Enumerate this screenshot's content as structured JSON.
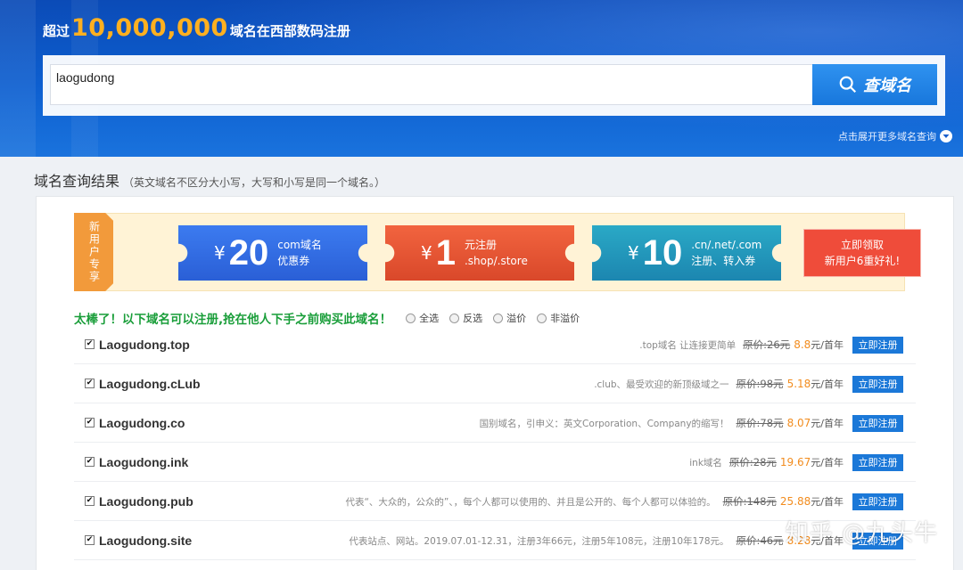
{
  "header": {
    "title_prefix": "超过",
    "title_number": "10,000,000",
    "title_suffix": "域名在西部数码注册",
    "search_value": "laogudong",
    "search_button": "查域名",
    "more_link": "点击展开更多域名查询"
  },
  "results": {
    "heading": "域名查询结果",
    "heading_note": "（英文域名不区分大小写，大写和小写是同一个域名。）"
  },
  "promo": {
    "tag": "新用户专享",
    "coupons": [
      {
        "yen": "¥",
        "amount": "20",
        "line1": "com域名",
        "line2": "优惠券",
        "color": "#2f6de3"
      },
      {
        "yen": "¥",
        "amount": "1",
        "line1": "元注册",
        "line2": ".shop/.store",
        "color": "#e65633"
      },
      {
        "yen": "¥",
        "amount": "10",
        "line1": ".cn/.net/.com",
        "line2": "注册、转入券",
        "color": "#2398bb"
      }
    ],
    "claim_line1": "立即领取",
    "claim_line2": "新用户6重好礼!"
  },
  "filter": {
    "congrats": "太棒了！以下域名可以注册,抢在他人下手之前购买此域名！",
    "options": [
      "全选",
      "反选",
      "溢价",
      "非溢价"
    ]
  },
  "domains": [
    {
      "name": "Laogudong.top",
      "note": ".top域名 让连接更简单",
      "orig": "原价:26元",
      "price": "8.8",
      "unit": "元/首年",
      "button": "立即注册",
      "checked": "✔"
    },
    {
      "name": "Laogudong.cLub",
      "note": ".club、最受欢迎的新顶级域之一",
      "orig": "原价:98元",
      "price": "5.18",
      "unit": "元/首年",
      "button": "立即注册",
      "checked": "✔"
    },
    {
      "name": "Laogudong.co",
      "note": "国别域名，引申义：英文Corporation、Company的缩写！",
      "orig": "原价:78元",
      "price": "8.07",
      "unit": "元/首年",
      "button": "立即注册",
      "checked": "✔"
    },
    {
      "name": "Laogudong.ink",
      "note": "ink域名",
      "orig": "原价:28元",
      "price": "19.67",
      "unit": "元/首年",
      "button": "立即注册",
      "checked": "✔"
    },
    {
      "name": "Laogudong.pub",
      "note": "代表“、大众的，公众的”、，每个人都可以使用的、并且是公开的、每个人都可以体验的。",
      "orig": "原价:148元",
      "price": "25.88",
      "unit": "元/首年",
      "button": "立即注册",
      "checked": "✔"
    },
    {
      "name": "Laogudong.site",
      "note": "代表站点、网站。2019.07.01-12.31，注册3年66元，注册5年108元，注册10年178元。",
      "orig": "原价:46元",
      "price": "8.28",
      "unit": "元/首年",
      "button": "立即注册",
      "checked": "✔"
    }
  ],
  "watermark": "知乎 @九头牛"
}
